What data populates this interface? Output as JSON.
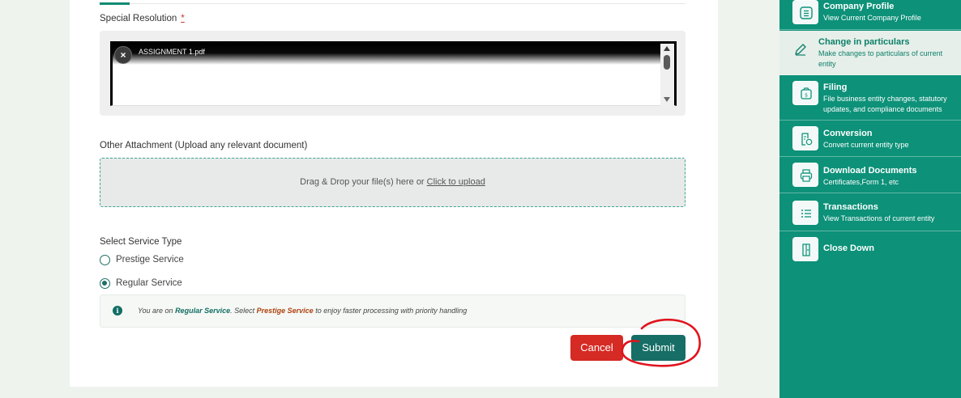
{
  "form": {
    "special_resolution_label": "Special Resolution",
    "required_mark": "*",
    "uploaded_file_name": "ASSIGNMENT 1.pdf",
    "remove_icon": "×",
    "other_attachment_label": "Other Attachment (Upload any relevant document)",
    "dropzone_text": "Drag & Drop your file(s) here or",
    "dropzone_link": "Click to upload",
    "service_type_label": "Select Service Type",
    "service_options": [
      {
        "label": "Prestige Service",
        "selected": false
      },
      {
        "label": "Regular Service",
        "selected": true
      }
    ],
    "notice": {
      "icon": "info-icon",
      "prefix": "You are on",
      "current": "Regular Service",
      "middle": ". Select",
      "upgrade": "Prestige Service",
      "suffix": "to enjoy faster processing with priority handling"
    },
    "cancel_label": "Cancel",
    "submit_label": "Submit"
  },
  "sidebar": {
    "items": [
      {
        "title": "Company Profile",
        "subtitle": "View Current Company Profile",
        "icon": "company-profile-icon",
        "active": false
      },
      {
        "title": "Change in particulars",
        "subtitle": "Make changes to particulars of current entity",
        "icon": "pencil-icon",
        "active": true
      },
      {
        "title": "Filing",
        "subtitle": "File business entity changes, statutory updates, and compliance documents",
        "icon": "filing-icon",
        "active": false
      },
      {
        "title": "Conversion",
        "subtitle": "Convert current entity type",
        "icon": "conversion-icon",
        "active": false
      },
      {
        "title": "Download Documents",
        "subtitle": "Certificates,Form 1, etc",
        "icon": "printer-icon",
        "active": false
      },
      {
        "title": "Transactions",
        "subtitle": "View Transactions of current entity",
        "icon": "list-icon",
        "active": false
      },
      {
        "title": "Close Down",
        "subtitle": "",
        "icon": "close-down-icon",
        "active": false
      }
    ]
  },
  "colors": {
    "brand": "#0d9179",
    "cancel": "#d62a24",
    "submit": "#166e66",
    "annotation": "#e0141e"
  }
}
